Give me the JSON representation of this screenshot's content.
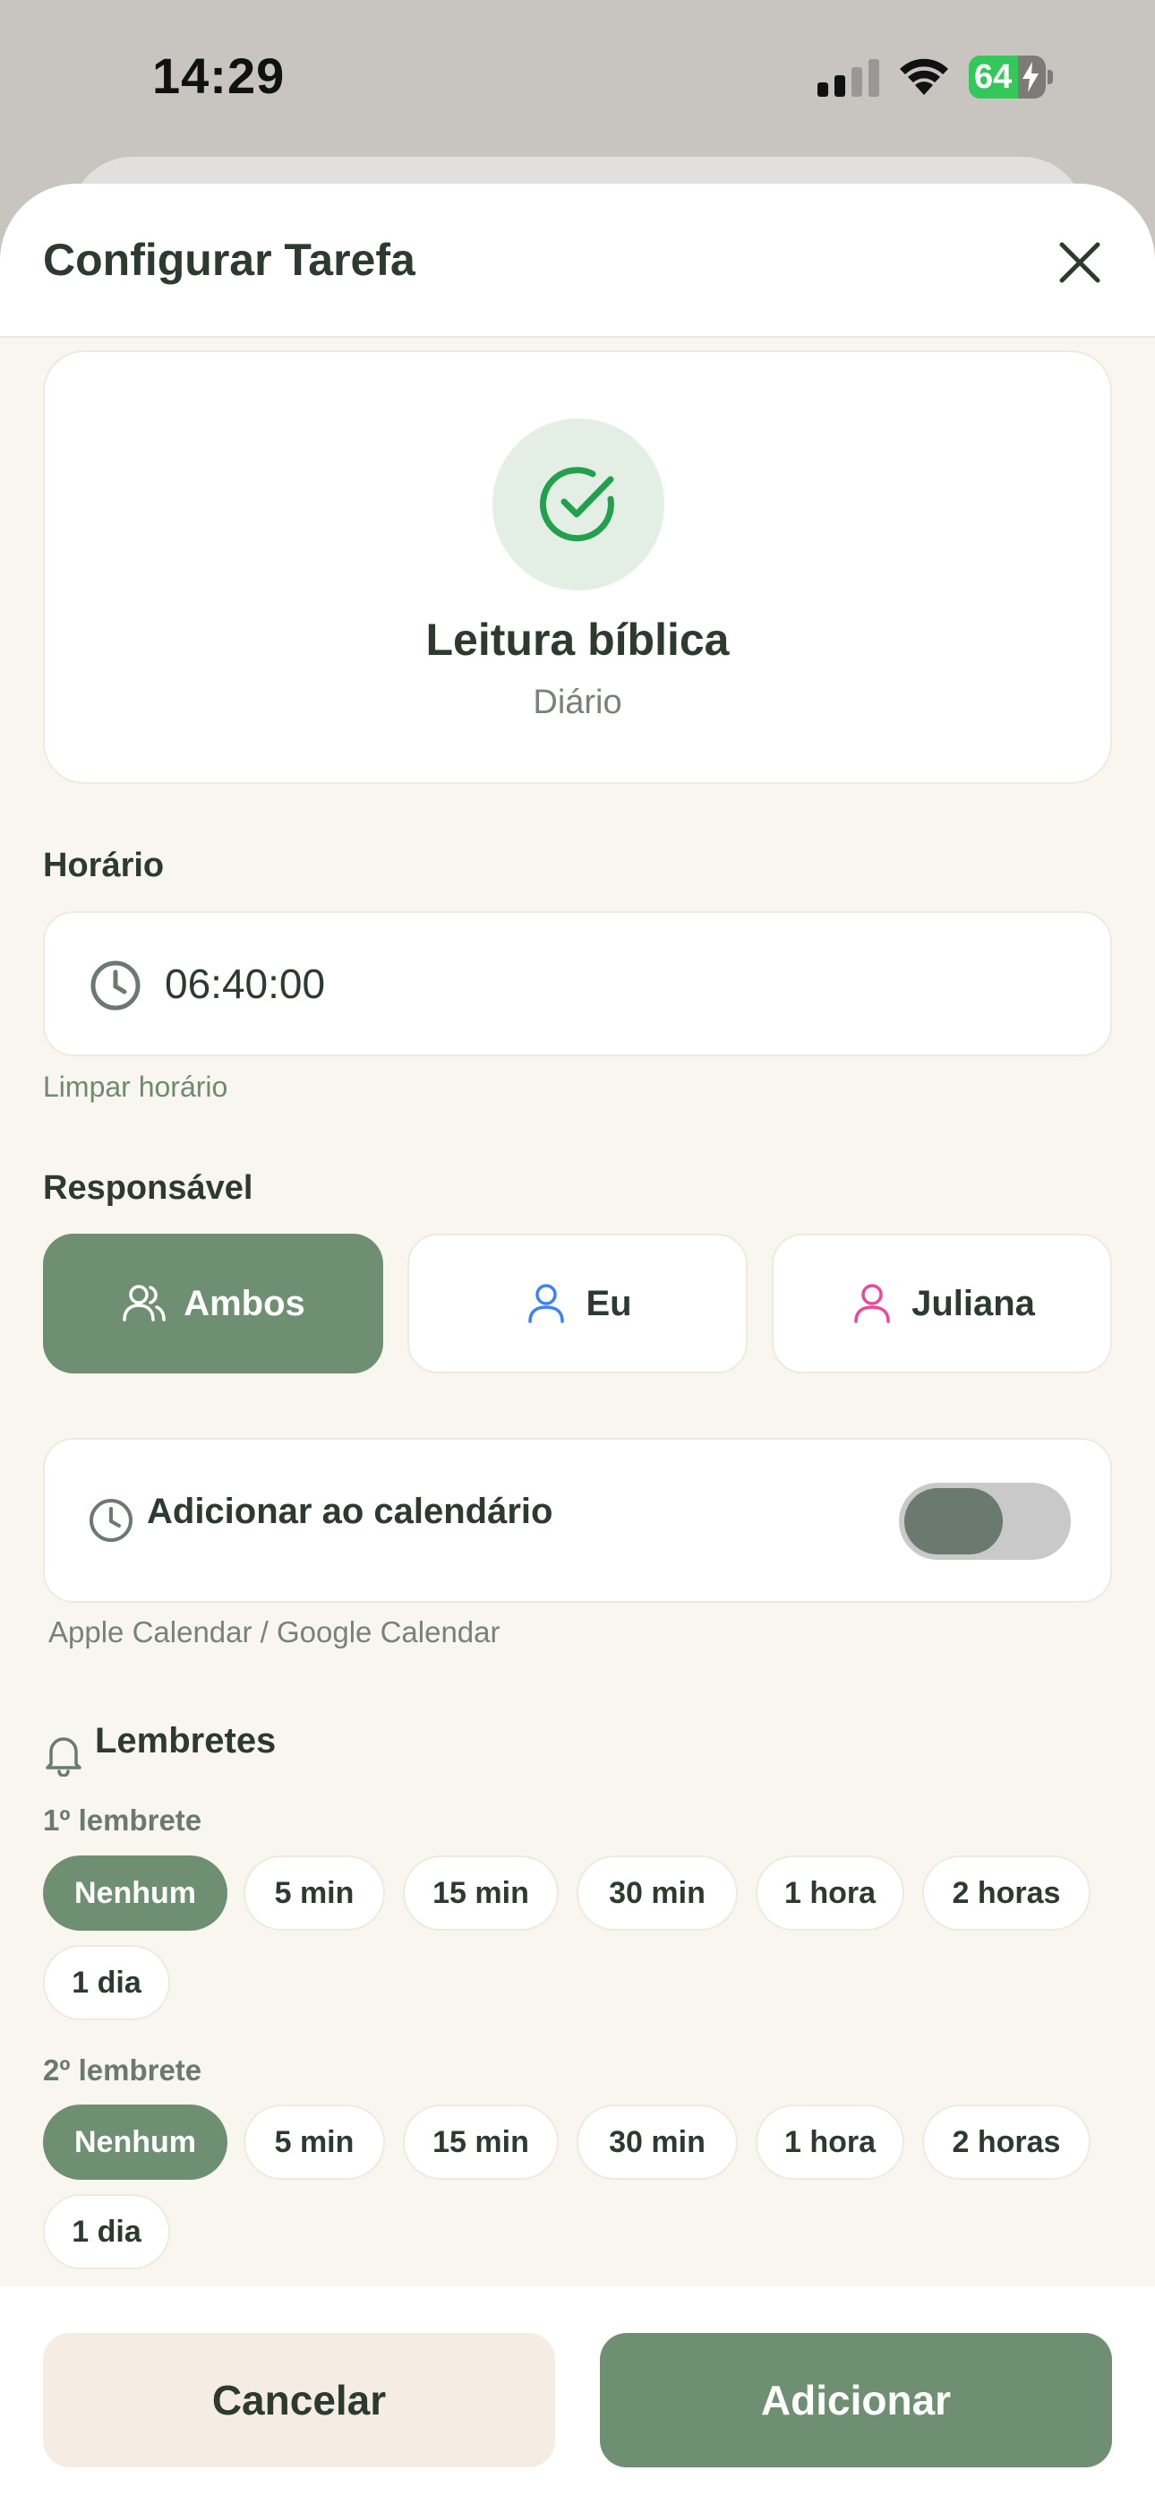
{
  "status_bar": {
    "time": "14:29",
    "battery_percent": "64",
    "battery_level": 0.64
  },
  "sheet": {
    "title": "Configurar Tarefa"
  },
  "task": {
    "title": "Leitura bíblica",
    "frequency": "Diário"
  },
  "schedule": {
    "label": "Horário",
    "value": "06:40:00",
    "clear_label": "Limpar horário"
  },
  "responsible": {
    "label": "Responsável",
    "options": [
      {
        "label": "Ambos",
        "icon": "users-icon"
      },
      {
        "label": "Eu",
        "icon": "user-icon",
        "color": "#3b82f6"
      },
      {
        "label": "Juliana",
        "icon": "user-icon",
        "color": "#ec4899"
      }
    ],
    "selected": "Ambos"
  },
  "calendar": {
    "label": "Adicionar ao calendário",
    "subtitle": "Apple Calendar / Google Calendar",
    "enabled": false
  },
  "reminders": {
    "label": "Lembretes",
    "first": {
      "label": "1º lembrete",
      "options": [
        "Nenhum",
        "5 min",
        "15 min",
        "30 min",
        "1 hora",
        "2 horas",
        "1 dia"
      ],
      "selected": "Nenhum"
    },
    "second": {
      "label": "2º lembrete",
      "options": [
        "Nenhum",
        "5 min",
        "15 min",
        "30 min",
        "1 hora",
        "2 horas",
        "1 dia"
      ],
      "selected": "Nenhum"
    }
  },
  "footer": {
    "cancel_label": "Cancelar",
    "add_label": "Adicionar"
  },
  "colors": {
    "accent": "#6f8f72",
    "text": "#2d3a30",
    "background": "#f9f6f0",
    "success": "#22a04b"
  }
}
